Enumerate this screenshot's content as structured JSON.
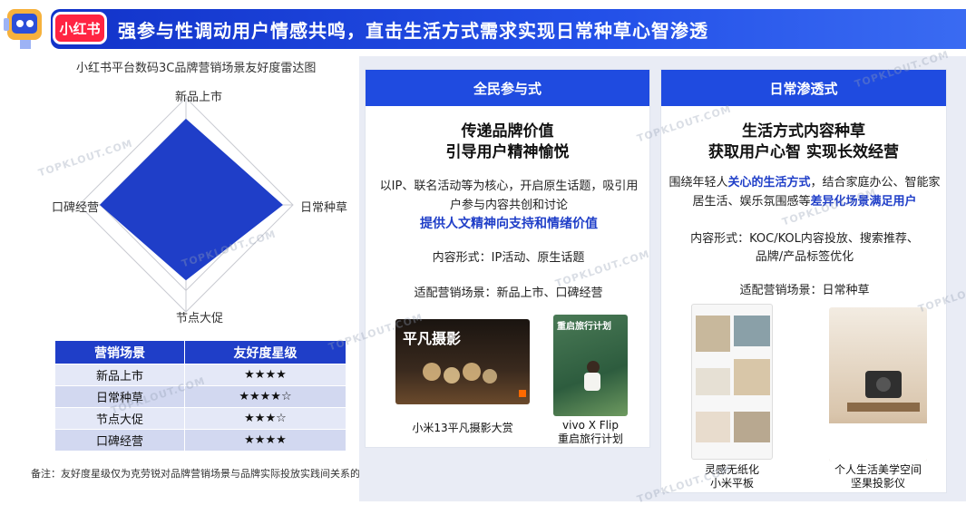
{
  "header": {
    "logo_text": "小红书",
    "title": "强参与性调动用户情感共鸣，直击生活方式需求实现日常种草心智渗透"
  },
  "watermark": "TOPKLOUT.COM",
  "radar": {
    "title": "小红书平台数码3C品牌营销场景友好度雷达图",
    "axes": [
      "新品上市",
      "日常种草",
      "节点大促",
      "口碑经营"
    ],
    "fill_color": "#1f3ec8"
  },
  "chart_data": {
    "type": "radar",
    "title": "小红书平台数码3C品牌营销场景友好度雷达图",
    "categories": [
      "新品上市",
      "日常种草",
      "节点大促",
      "口碑经营"
    ],
    "values": [
      4,
      4.5,
      3.5,
      4
    ],
    "max": 5
  },
  "table": {
    "headers": [
      "营销场景",
      "友好度星级"
    ],
    "rows": [
      [
        "新品上市",
        "★★★★"
      ],
      [
        "日常种草",
        "★★★★☆"
      ],
      [
        "节点大促",
        "★★★☆"
      ],
      [
        "口碑经营",
        "★★★★"
      ]
    ]
  },
  "note": "备注：友好度星级仅为克劳锐对品牌营销场景与品牌实际投放实践间关系的研究评价，不代表平台官方立场，不代表市场真实水平",
  "card1": {
    "header": "全民参与式",
    "heading1": "传递品牌价值",
    "heading2": "引导用户精神愉悦",
    "para1": "以IP、联名活动等为核心，开启原生话题，吸引用户参与内容共创和讨论",
    "para1_emph": "提供人文精神向支持和情绪价值",
    "content_form": "内容形式：IP活动、原生话题",
    "scene": "适配营销场景：新品上市、口碑经营",
    "thumb1_text": "平凡摄影",
    "thumb2_text": "重启旅行计划",
    "caption1": "小米13平凡摄影大赏",
    "caption2a": "vivo X Flip",
    "caption2b": "重启旅行计划"
  },
  "card2": {
    "header": "日常渗透式",
    "heading1": "生活方式内容种草",
    "heading2": "获取用户心智  实现长效经营",
    "para_a": "围绕年轻人",
    "para_b": "关心的生活方式",
    "para_c": "，结合家庭办公、智能家居生活、娱乐氛围感等",
    "para_d": "差异化场景满足用户",
    "content_form1": "内容形式：KOC/KOL内容投放、搜索推荐、",
    "content_form2": "品牌/产品标签优化",
    "scene": "适配营销场景：日常种草",
    "caption1a": "灵感无纸化",
    "caption1b": "小米平板",
    "caption2a": "个人生活美学空间",
    "caption2b": "坚果投影仪"
  }
}
